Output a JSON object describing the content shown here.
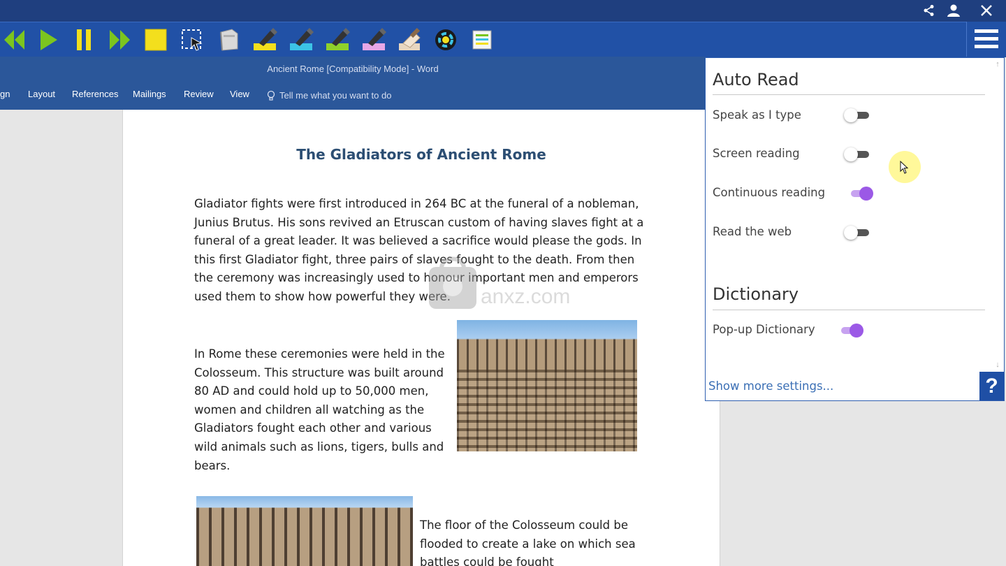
{
  "topbar": {
    "icons": [
      "share-icon",
      "user-icon",
      "close-icon"
    ]
  },
  "toolbar": {
    "tools": [
      "rewind-icon",
      "play-icon",
      "pause-icon",
      "fast-forward-icon",
      "stop-icon",
      "screenshot-reader-icon",
      "audio-maker-icon",
      "highlight-yellow-icon",
      "highlight-blue-icon",
      "highlight-green-icon",
      "highlight-pink-icon",
      "clear-highlights-icon",
      "collect-highlights-icon",
      "vocabulary-icon"
    ],
    "menu_icon": "hamburger-menu-icon",
    "colors": {
      "bar": "#2151a6",
      "topbar": "#1f3f7f",
      "yellow": "#f3df1d",
      "green": "#7cc51f"
    }
  },
  "word": {
    "window_title": "Ancient Rome [Compatibility Mode]  -  Word",
    "ribbon_tabs": [
      "gn",
      "Layout",
      "References",
      "Mailings",
      "Review",
      "View"
    ],
    "tell_me": "Tell me what you want to do",
    "document": {
      "title": "The Gladiators of Ancient Rome",
      "paragraphs": [
        "Gladiator fights were first introduced in 264 BC at the funeral of a nobleman, Junius Brutus. His sons revived an Etruscan custom of having slaves fight at a funeral of a great leader. It was believed a sacrifice would please the gods. In this first Gladiator fight, three pairs of slaves fought to the death.  From then the ceremony was increasingly used to honour important men and emperors used them to show how powerful they were.",
        "In Rome these ceremonies were held in the Colosseum.  This structure was built around 80 AD and could hold up to 50,000 men, women and children all watching as the Gladiators fought each other and various wild animals such as lions, tigers, bulls and bears.",
        "The floor of the Colosseum could be flooded to create a lake on which sea battles could be fought"
      ]
    }
  },
  "panel": {
    "auto_read": {
      "title": "Auto Read",
      "items": [
        {
          "label": "Speak as I type",
          "on": false
        },
        {
          "label": "Screen reading",
          "on": false
        },
        {
          "label": "Continuous reading",
          "on": true
        },
        {
          "label": "Read the web",
          "on": false
        }
      ]
    },
    "dictionary": {
      "title": "Dictionary",
      "items": [
        {
          "label": "Pop-up Dictionary",
          "on": true
        }
      ]
    },
    "more_settings": "Show more settings...",
    "help": "?"
  },
  "watermark": {
    "text": "anxz.com"
  }
}
